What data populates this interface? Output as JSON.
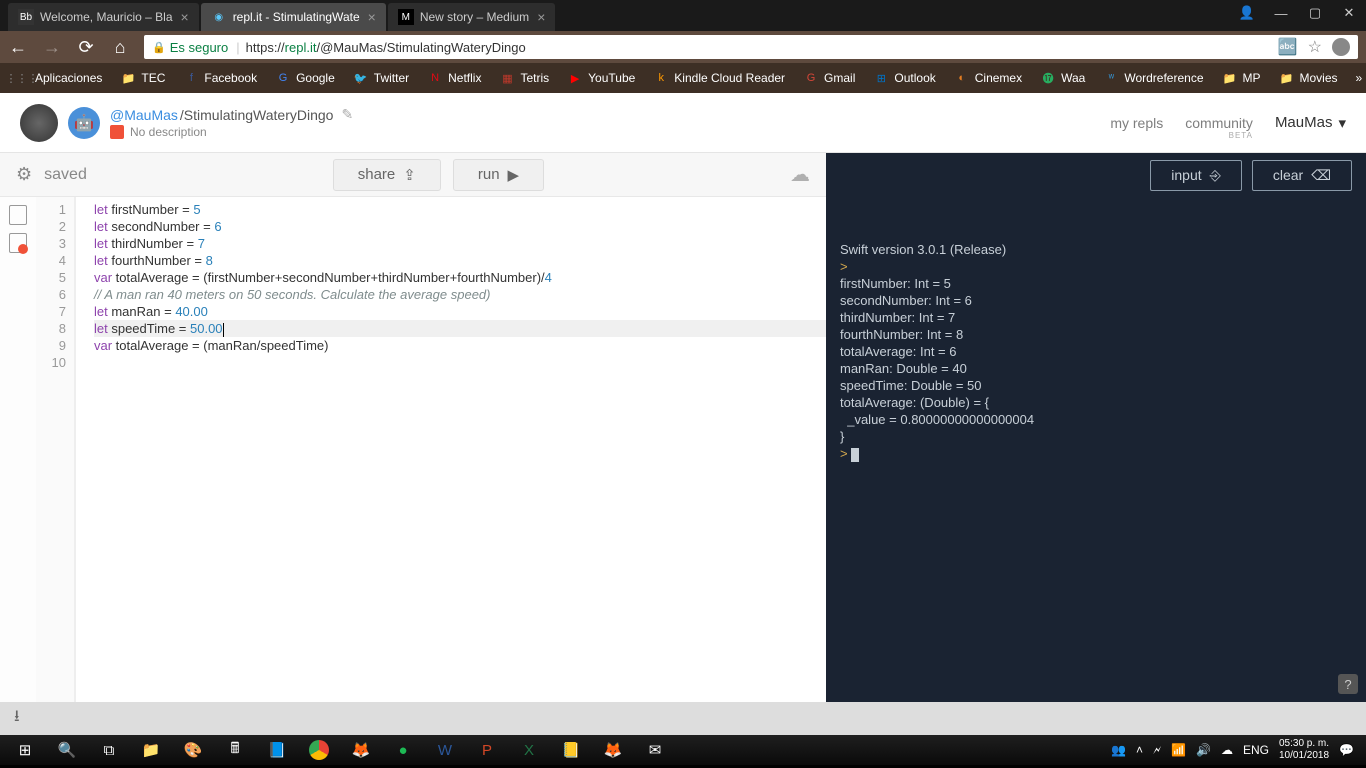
{
  "browser": {
    "tabs": [
      {
        "title": "Welcome, Mauricio – Bla",
        "favicon": "Bb"
      },
      {
        "title": "repl.it - StimulatingWate",
        "favicon": "◉",
        "active": true
      },
      {
        "title": "New story – Medium",
        "favicon": "M"
      }
    ],
    "secure_label": "Es seguro",
    "url_prefix": "https://",
    "url_domain": "repl.it",
    "url_path": "/@MauMas/StimulatingWateryDingo",
    "bookmarks": [
      {
        "label": "Aplicaciones",
        "icon": "⋮⋮⋮",
        "color": "#888"
      },
      {
        "label": "TEC",
        "icon": "📁",
        "color": "#d4a94e"
      },
      {
        "label": "Facebook",
        "icon": "f",
        "color": "#3b5998"
      },
      {
        "label": "Google",
        "icon": "G",
        "color": "#4285f4"
      },
      {
        "label": "Twitter",
        "icon": "🐦",
        "color": "#1da1f2"
      },
      {
        "label": "Netflix",
        "icon": "N",
        "color": "#e50914"
      },
      {
        "label": "Tetris",
        "icon": "▦",
        "color": "#c0392b"
      },
      {
        "label": "YouTube",
        "icon": "▶",
        "color": "#ff0000"
      },
      {
        "label": "Kindle Cloud Reader",
        "icon": "k",
        "color": "#ff9900"
      },
      {
        "label": "Gmail",
        "icon": "G",
        "color": "#d44638"
      },
      {
        "label": "Outlook",
        "icon": "⊞",
        "color": "#0072c6"
      },
      {
        "label": "Cinemex",
        "icon": "◐",
        "color": "#e67e22"
      },
      {
        "label": "Waa",
        "icon": "⓱",
        "color": "#27ae60"
      },
      {
        "label": "Wordreference",
        "icon": "ʷ",
        "color": "#3498db"
      },
      {
        "label": "MP",
        "icon": "📁",
        "color": "#d4a94e"
      },
      {
        "label": "Movies",
        "icon": "📁",
        "color": "#d4a94e"
      }
    ]
  },
  "repl": {
    "user": "@MauMas",
    "name": "/StimulatingWateryDingo",
    "description": "No description",
    "nav_myrepls": "my repls",
    "nav_community": "community",
    "beta": "BETA",
    "username": "MauMas"
  },
  "toolbar": {
    "status": "saved",
    "share": "share",
    "run": "run"
  },
  "console": {
    "input_btn": "input",
    "clear_btn": "clear",
    "output": "Swift version 3.0.1 (Release)\n \nfirstNumber: Int = 5\nsecondNumber: Int = 6\nthirdNumber: Int = 7\nfourthNumber: Int = 8\ntotalAverage: Int = 6\nmanRan: Double = 40\nspeedTime: Double = 50\ntotalAverage: (Double) = {\n  _value = 0.80000000000000004\n}\n  "
  },
  "code": {
    "lines": [
      {
        "n": 1,
        "tokens": [
          {
            "t": "let",
            "c": "kw"
          },
          {
            "t": " firstNumber = "
          },
          {
            "t": "5",
            "c": "num"
          }
        ]
      },
      {
        "n": 2,
        "tokens": [
          {
            "t": "let",
            "c": "kw"
          },
          {
            "t": " secondNumber = "
          },
          {
            "t": "6",
            "c": "num"
          }
        ]
      },
      {
        "n": 3,
        "tokens": [
          {
            "t": "let",
            "c": "kw"
          },
          {
            "t": " thirdNumber = "
          },
          {
            "t": "7",
            "c": "num"
          }
        ]
      },
      {
        "n": 4,
        "tokens": [
          {
            "t": "let",
            "c": "kw"
          },
          {
            "t": " fourthNumber = "
          },
          {
            "t": "8",
            "c": "num"
          }
        ]
      },
      {
        "n": 5,
        "tokens": [
          {
            "t": "var",
            "c": "kw"
          },
          {
            "t": " totalAverage = (firstNumber+secondNumber+thirdNumber+fourthNumber)/"
          },
          {
            "t": "4",
            "c": "num"
          }
        ]
      },
      {
        "n": 6,
        "tokens": [
          {
            "t": "// A man ran 40 meters on 50 seconds. Calculate the average speed)",
            "c": "com"
          }
        ]
      },
      {
        "n": 7,
        "tokens": [
          {
            "t": "let",
            "c": "kw"
          },
          {
            "t": " manRan = "
          },
          {
            "t": "40.00",
            "c": "num"
          }
        ]
      },
      {
        "n": 8,
        "hl": true,
        "tokens": [
          {
            "t": "let",
            "c": "kw"
          },
          {
            "t": " speedTime = "
          },
          {
            "t": "50.00",
            "c": "num"
          }
        ],
        "cursor": true
      },
      {
        "n": 9,
        "tokens": [
          {
            "t": "var",
            "c": "kw"
          },
          {
            "t": " totalAverage = (manRan/speedTime)"
          }
        ]
      },
      {
        "n": 10,
        "tokens": []
      }
    ]
  },
  "taskbar": {
    "lang": "ENG",
    "time": "05:30 p. m.",
    "date": "10/01/2018"
  }
}
